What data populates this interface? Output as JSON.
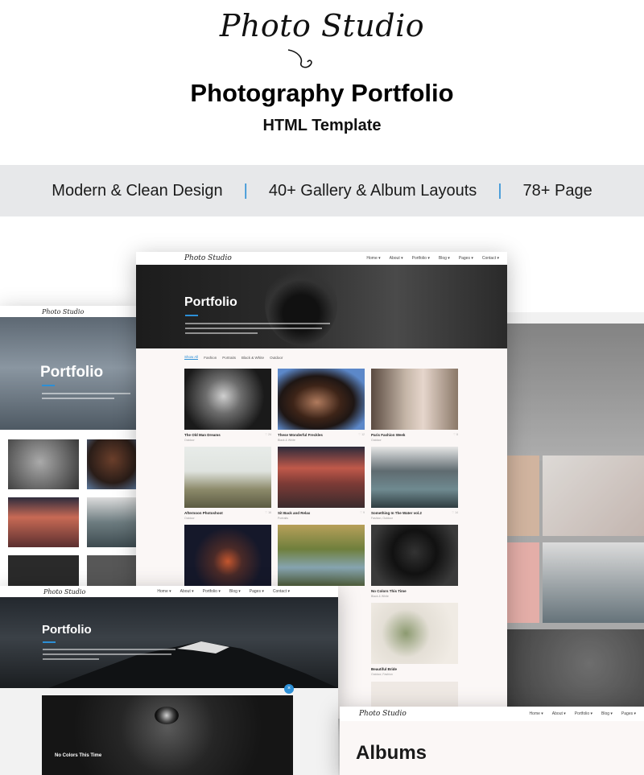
{
  "header": {
    "logo_text": "Photo Studio",
    "title": "Photography Portfolio",
    "subtitle": "HTML Template"
  },
  "features": [
    "Modern & Clean Design",
    "40+ Gallery & Album Layouts",
    "78+ Page"
  ],
  "colors": {
    "accent": "#2c8fd6",
    "band_bg": "#e7e8ea",
    "mock_bg": "#fbf7f6"
  },
  "mockup_main": {
    "logo": "Photo Studio",
    "menu": [
      "Home ▾",
      "About ▾",
      "Portfolio ▾",
      "Blog ▾",
      "Pages ▾",
      "Contact ▾"
    ],
    "hero_title": "Portfolio",
    "filters": [
      "Show All",
      "Fashion",
      "Portraits",
      "Black & White",
      "Outdoor"
    ],
    "cards": [
      {
        "title": "The Old Man Dreams",
        "sub": "Outdoor",
        "count": "♡ 24"
      },
      {
        "title": "These Wonderful Freckles",
        "sub": "Black & White",
        "count": "♡ 12"
      },
      {
        "title": "Paris Fashion Week",
        "sub": "Outdoor",
        "count": "♡ 8"
      },
      {
        "title": "Afternoon Photoshoot",
        "sub": "Outdoor",
        "count": "♡ 16"
      },
      {
        "title": "Sit Back and Relax",
        "sub": "Portraits",
        "count": "♡ 9"
      },
      {
        "title": "Something In The Water vol.2",
        "sub": "Fashion, Outdoor",
        "count": "♡ 14"
      },
      {
        "title": "",
        "sub": "",
        "count": ""
      },
      {
        "title": "",
        "sub": "",
        "count": ""
      },
      {
        "title": "No Colors This Time",
        "sub": "Black & White",
        "count": ""
      },
      {
        "title": "Beautiful Bride",
        "sub": "Outdoor, Fashion",
        "count": ""
      }
    ]
  },
  "mockup_left": {
    "logo": "Photo Studio",
    "hero_title": "Portfolio"
  },
  "mockup_bottom_left": {
    "logo": "Photo Studio",
    "menu": [
      "Home ▾",
      "About ▾",
      "Portfolio ▾",
      "Blog ▾",
      "Pages ▾",
      "Contact ▾"
    ],
    "hero_title": "Portfolio",
    "caption": "No Colors This Time"
  },
  "mockup_bottom_right": {
    "logo": "Photo Studio",
    "menu": [
      "Home ▾",
      "About ▾",
      "Portfolio ▾",
      "Blog ▾",
      "Pages ▾"
    ],
    "title": "Albums"
  }
}
